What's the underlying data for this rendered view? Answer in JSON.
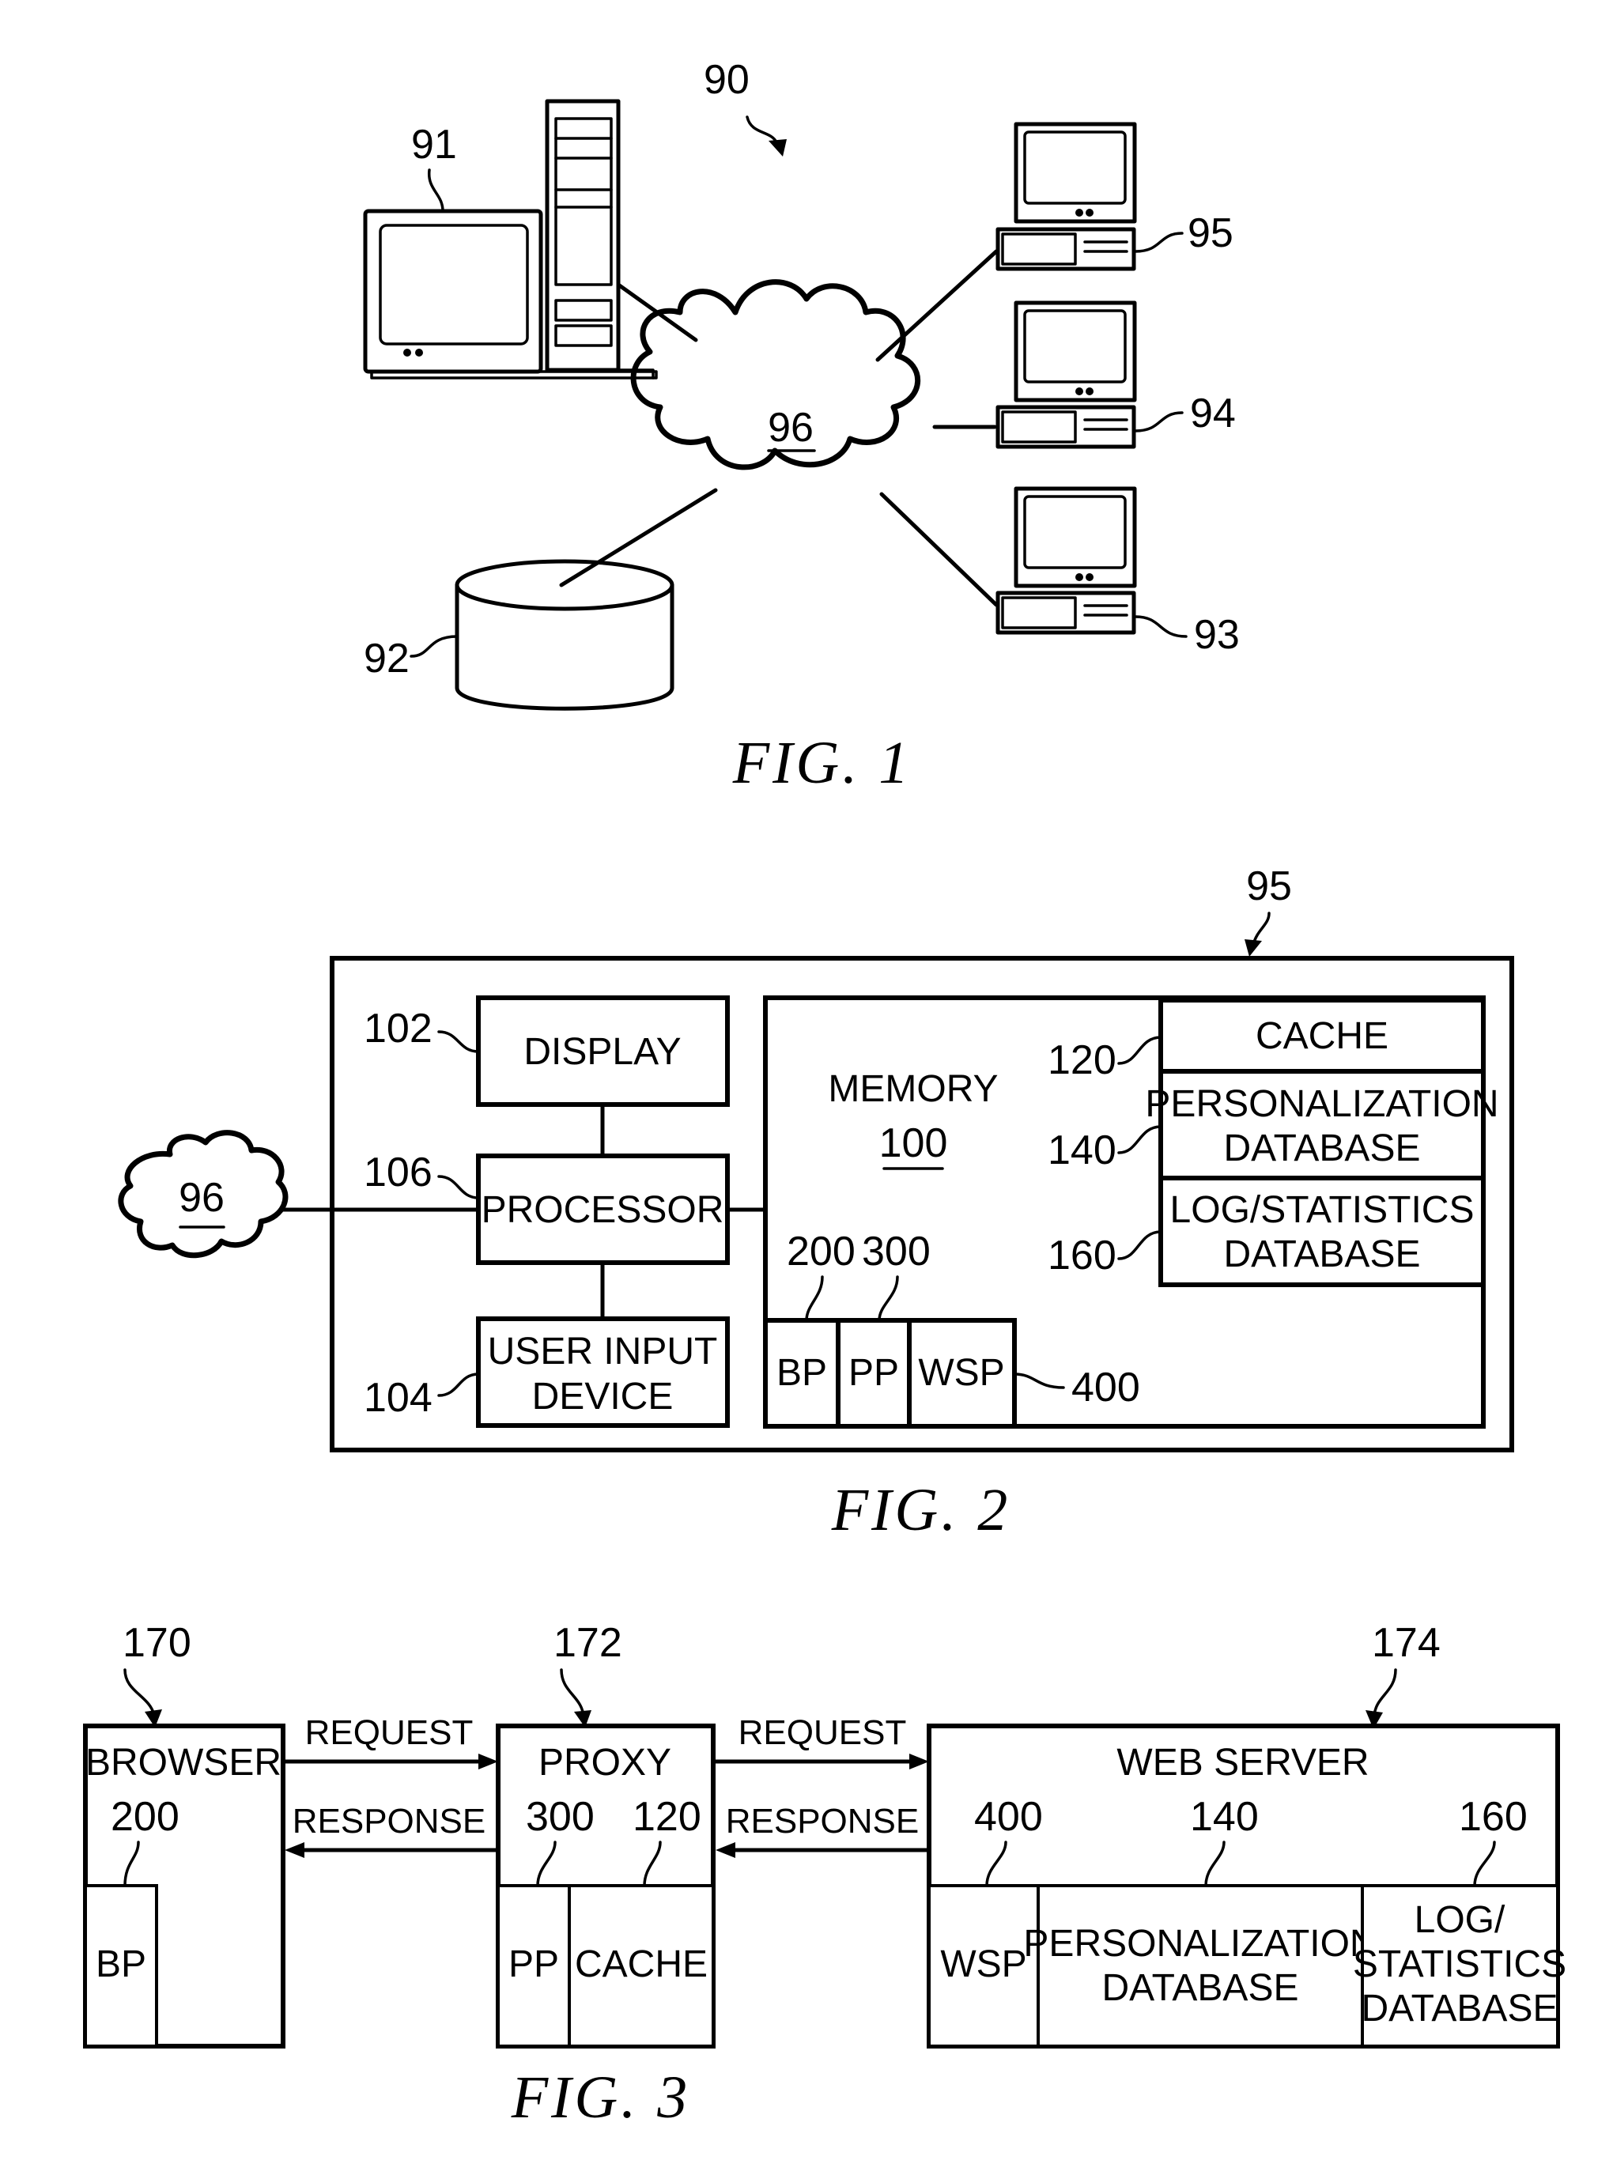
{
  "fig1": {
    "caption": "FIG. 1",
    "system_ref": "90",
    "network": {
      "ref": "96",
      "icon": "cloud-icon"
    },
    "server": {
      "ref": "91",
      "icon": "server-workstation-icon"
    },
    "database": {
      "ref": "92",
      "icon": "database-cylinder-icon"
    },
    "clients": [
      {
        "ref": "95",
        "icon": "desktop-computer-icon"
      },
      {
        "ref": "94",
        "icon": "desktop-computer-icon"
      },
      {
        "ref": "93",
        "icon": "desktop-computer-icon"
      }
    ]
  },
  "fig2": {
    "caption": "FIG. 2",
    "device_ref": "95",
    "network_ref": "96",
    "display": {
      "label": "DISPLAY",
      "ref": "102"
    },
    "processor": {
      "label": "PROCESSOR",
      "ref": "106"
    },
    "input": {
      "label_line1": "USER INPUT",
      "label_line2": "DEVICE",
      "ref": "104"
    },
    "memory": {
      "label": "MEMORY",
      "ref": "100"
    },
    "cache": {
      "label": "CACHE",
      "ref": "120"
    },
    "personalization_db": {
      "label_line1": "PERSONALIZATION",
      "label_line2": "DATABASE",
      "ref": "140"
    },
    "log_db": {
      "label_line1": "LOG/STATISTICS",
      "label_line2": "DATABASE",
      "ref": "160"
    },
    "plugins": [
      {
        "label": "BP",
        "ref": "200"
      },
      {
        "label": "PP",
        "ref": "300"
      },
      {
        "label": "WSP",
        "ref": "400"
      }
    ]
  },
  "fig3": {
    "caption": "FIG. 3",
    "browser": {
      "label": "BROWSER",
      "ref": "170",
      "plugin_label": "BP",
      "plugin_ref": "200"
    },
    "proxy": {
      "label": "PROXY",
      "ref": "172",
      "plugin_label": "PP",
      "plugin_ref": "300",
      "cache_label": "CACHE",
      "cache_ref": "120"
    },
    "web_server": {
      "label": "WEB SERVER",
      "ref": "174",
      "plugin_label": "WSP",
      "plugin_ref": "400",
      "personalization_line1": "PERSONALIZATION",
      "personalization_line2": "DATABASE",
      "personalization_ref": "140",
      "log_line1": "LOG/",
      "log_line2": "STATISTICS",
      "log_line3": "DATABASE",
      "log_ref": "160"
    },
    "arrows": {
      "request_1": "REQUEST",
      "response_1": "RESPONSE",
      "request_2": "REQUEST",
      "response_2": "RESPONSE"
    }
  }
}
